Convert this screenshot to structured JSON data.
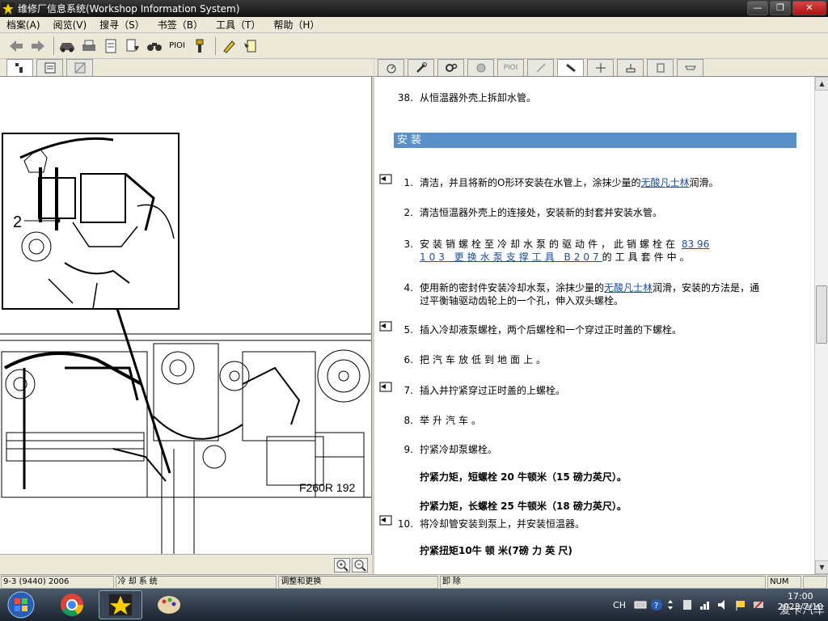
{
  "window": {
    "title": "维修厂信息系统(Workshop Information System)",
    "btn_min": "—",
    "btn_max": "❐",
    "btn_close": "✕"
  },
  "menu": [
    "档案(A)",
    "阅览(V)",
    "搜寻（S）",
    "书签（B）",
    "工具（T）",
    "帮助（H）"
  ],
  "toolbar": {
    "pioi": "PIOI"
  },
  "tabs_right": {
    "pioi": "PIOI"
  },
  "figure": {
    "label": "F260R 192",
    "callout": "2"
  },
  "content": {
    "step38": {
      "num": "38.",
      "text": "从恒温器外壳上拆卸水管。"
    },
    "section_title": "安装",
    "steps": [
      {
        "num": "1.",
        "pre": "清洁，并且将新的O形环安装在水管上，涂抹少量的",
        "link": "无酸凡士林",
        "post": "润滑。"
      },
      {
        "num": "2.",
        "text": "清洁恒温器外壳上的连接处，安装新的封套并安装水管。"
      },
      {
        "num": "3.",
        "pre": "安装销螺栓至冷却水泵的驱动件，此销螺栓在",
        "link1": "83 96",
        "link2": "103 更换水泵支撑工具 B207",
        "post": "的工具套件中。"
      },
      {
        "num": "4.",
        "pre": "使用新的密封件安装冷却水泵，涂抹少量的",
        "link": "无酸凡士林",
        "post": "润滑，安装的方法是，通",
        "line2": "过平衡轴驱动齿轮上的一个孔，伸入双头螺栓。"
      },
      {
        "num": "5.",
        "text": "插入冷却液泵螺栓，两个后螺栓和一个穿过正时盖的下螺栓。"
      },
      {
        "num": "6.",
        "text": "把汽车放低到地面上。"
      },
      {
        "num": "7.",
        "text": "插入并拧紧穿过正时盖的上螺栓。"
      },
      {
        "num": "8.",
        "text": "举升汽车。"
      },
      {
        "num": "9.",
        "text": "拧紧冷却泵螺栓。"
      },
      {
        "num": "10.",
        "text": "将冷却管安装到泵上，并安装恒温器。"
      }
    ],
    "torque1": "拧紧力矩，短螺栓 20 牛顿米（15 磅力英尺）。",
    "torque2": "拧紧力矩，长螺栓 25 牛顿米（18 磅力英尺）。",
    "torque3": "拧紧扭矩10牛 顿 米(7磅 力 英 尺)"
  },
  "statusbar": {
    "model": "9-3 (9440) 2006",
    "system": "冷却系统",
    "operation": "调整和更换",
    "action": "卸除",
    "num": "NUM"
  },
  "taskbar": {
    "lang": "CH",
    "time": "17:00",
    "date": "2023/7/10"
  },
  "watermark": "爱卡汽车",
  "colors": {
    "section_bar": "#5b8fc8",
    "link": "#1a4fa0"
  }
}
